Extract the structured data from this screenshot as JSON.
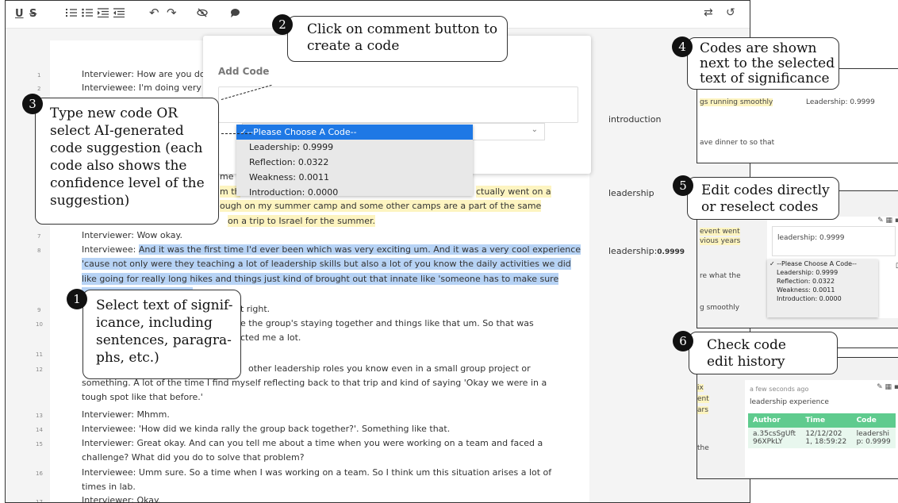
{
  "toolbar": {
    "underline": "U",
    "strike": "S",
    "undo": "↶",
    "redo": "↷",
    "swap": "⇄",
    "history": "↺"
  },
  "transcript": {
    "lines": [
      {
        "num": "1",
        "text": "Interviewer: How are you doing t"
      },
      {
        "num": "2",
        "text": "Interviewee: I'm doing very well. I"
      },
      {
        "num": "",
        "text": "me"
      },
      {
        "num": "",
        "text": "m th"
      },
      {
        "num": "",
        "text": "ough on my summer camp and some other camps are a part of the same"
      },
      {
        "num": "",
        "text": "on a trip to Israel for the summer."
      },
      {
        "num": "7",
        "text": "Interviewer: Wow  okay."
      },
      {
        "num": "8",
        "text": "Interviewee: And it was the first time I'd ever been  which was very exciting um. And it was a very cool experience"
      },
      {
        "num": "",
        "text": "'cause not only were they teaching a lot of leadership skills  but also a lot of you know the daily activities we did"
      },
      {
        "num": "",
        "text": "like going for really long hikes and things just kind of brought out that innate like  'someone has to make sure"
      },
      {
        "num": "9",
        "text": "t right."
      },
      {
        "num": "10",
        "text": "e the group's staying together and things like that  um. So that was"
      },
      {
        "num": "",
        "text": "cted me a lot."
      },
      {
        "num": "11",
        "text": ""
      },
      {
        "num": "12",
        "text": "other leadership roles  you know  even in a small group project or"
      },
      {
        "num": "",
        "text": "something. A lot of the time I find myself reflecting back to that trip and kind of saying  'Okay  we were in a"
      },
      {
        "num": "",
        "text": "tough spot like that before.'"
      },
      {
        "num": "13",
        "text": "Interviewer: Mhmm."
      },
      {
        "num": "14",
        "text": "Interviewee: 'How did we kinda rally the group back together?'. Something like that."
      },
      {
        "num": "15",
        "text": "Interviewer: Great  okay. And can you tell me about a time when you were working on a team and faced a"
      },
      {
        "num": "",
        "text": "challenge? What did you do to solve that problem?"
      },
      {
        "num": "16",
        "text": "Interviewee: Umm  sure. So  a time when I was working on a team. So I think  um  this situation arises a lot of"
      },
      {
        "num": "",
        "text": "times in lab."
      },
      {
        "num": "17",
        "text": "Interviewer: Okay."
      }
    ],
    "hl_partial": "ctually went on a"
  },
  "codes": {
    "introduction": "introduction",
    "leadership": "leadership",
    "leadership_score_label": "leadership:",
    "leadership_score": "0.9999"
  },
  "add_code": {
    "title": "Add Code",
    "options": [
      "--Please Choose A Code--",
      "Leadership: 0.9999",
      "Reflection: 0.0322",
      "Weakness: 0.0011",
      "Introduction: 0.0000"
    ],
    "check": "✓"
  },
  "callouts": {
    "c1": {
      "num": "1",
      "text": "Select text of signif-\nicance, including\nsentences, paragra-\nphs, etc.)"
    },
    "c2": {
      "num": "2",
      "text": "Click on comment button to\ncreate a code"
    },
    "c3": {
      "num": "3",
      "text": "Type new code OR\nselect AI-generated\ncode suggestion (each\ncode also shows the\nconfidence level of the\nsuggestion)"
    },
    "c4": {
      "num": "4",
      "text": "Codes are shown\nnext to the selected\ntext of significance"
    },
    "c5": {
      "num": "5",
      "text": "Edit codes directly\nor reselect codes"
    },
    "c6": {
      "num": "6",
      "text": "Check code\nedit history"
    }
  },
  "panel4": {
    "line1": "gs running smoothly",
    "code": "Leadership: 0.9999",
    "line2": "ave dinner to so that"
  },
  "panel5": {
    "left1": "event went",
    "left2": "vious years",
    "left3": "re what the",
    "left4": "g smoothly",
    "input": "leadership: 0.9999",
    "options": [
      "--Please Choose A Code--",
      "Leadership: 0.9999",
      "Reflection: 0.0322",
      "Weakness: 0.0011",
      "Introduction: 0.0000"
    ],
    "check": "✓"
  },
  "panel6": {
    "left1": "ix",
    "left2": "ent",
    "left3": "ars",
    "left4": "the",
    "time_ago": "a few seconds ago",
    "code_text": "leadership experience",
    "headers": [
      "Author",
      "Time",
      "Code"
    ],
    "row": [
      "a.35csSgUft\n96XPkLY",
      "12/12/202\n1, 18:59:22",
      "leadershi\np: 0.9999"
    ]
  }
}
